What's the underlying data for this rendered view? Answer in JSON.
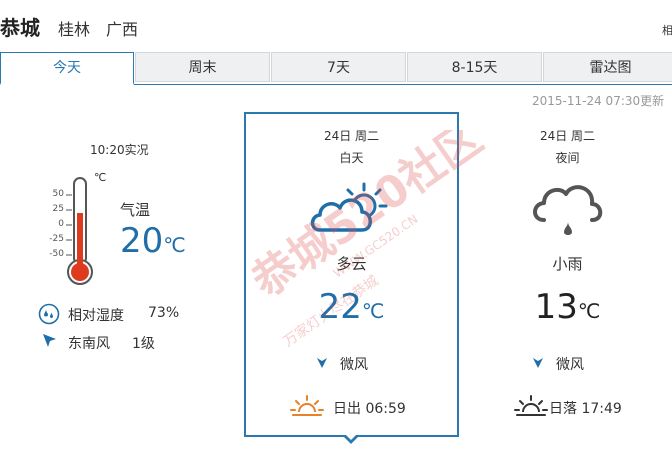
{
  "header": {
    "city": "恭城",
    "region1": "桂林",
    "region2": "广西",
    "cut_text": "相"
  },
  "tabs": [
    {
      "label": "今天",
      "active": true
    },
    {
      "label": "周末",
      "active": false
    },
    {
      "label": "7天",
      "active": false
    },
    {
      "label": "8-15天",
      "active": false
    },
    {
      "label": "雷达图",
      "active": false
    }
  ],
  "updated": "2015-11-24 07:30更新",
  "current": {
    "time_label": "10:20实况",
    "unit": "℃",
    "scale": [
      "50",
      "25",
      "0",
      "-25",
      "-50"
    ],
    "scale_ticks": [
      "50",
      "25",
      "0",
      "-25",
      "-50"
    ],
    "temp_label": "气温",
    "temp_value": "20",
    "temp_unit": "℃",
    "humidity_label": "相对湿度",
    "humidity_value": "73%",
    "wind_dir": "东南风",
    "wind_level": "1级",
    "thermometer_reading": 20
  },
  "day": {
    "date": "24日 周二",
    "period": "白天",
    "condition": "多云",
    "temp": "22",
    "unit": "℃",
    "wind": "微风",
    "sun_label": "日出 06:59",
    "icon": "partly-cloudy-icon"
  },
  "night": {
    "date": "24日 周二",
    "period": "夜间",
    "condition": "小雨",
    "temp": "13",
    "unit": "℃",
    "wind": "微风",
    "sun_label": "日落 17:49",
    "icon": "light-rain-icon"
  },
  "watermark": {
    "text1": "恭城520社区",
    "text2": "WWW.GC520.CN",
    "text3": "万家灯火尽在恭城"
  },
  "colors": {
    "accent": "#2a7ab0",
    "temp": "#1f6ea8",
    "thermo_red": "#e03a1e",
    "sunrise": "#e8822a"
  }
}
